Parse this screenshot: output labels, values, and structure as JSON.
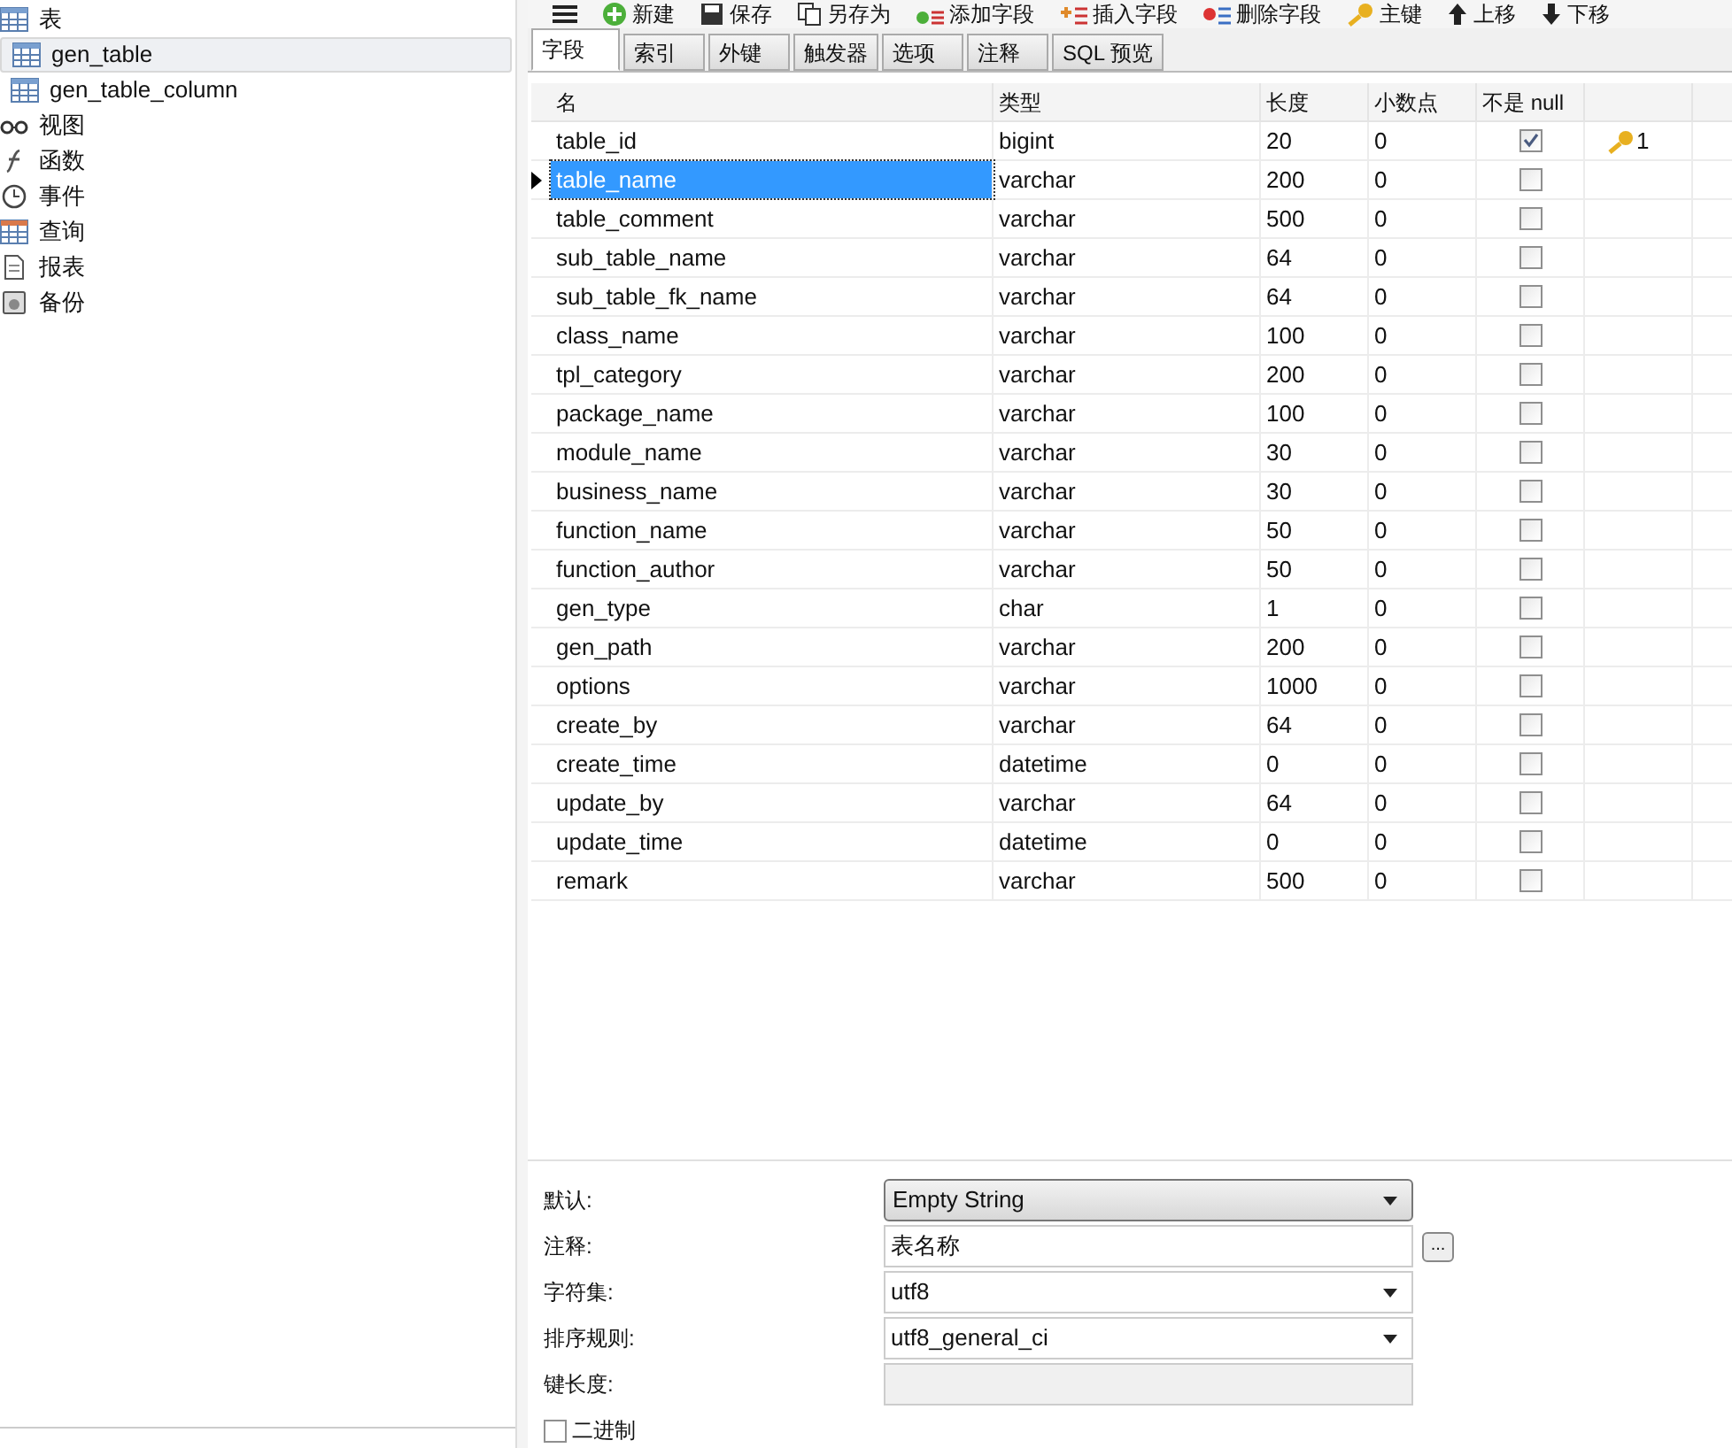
{
  "sidebar": {
    "items": [
      {
        "label": "表",
        "kind": "table-group",
        "selected": false,
        "children": [
          {
            "label": "gen_table",
            "kind": "table",
            "selected": true
          },
          {
            "label": "gen_table_column",
            "kind": "table",
            "selected": false
          }
        ]
      },
      {
        "label": "视图",
        "kind": "view",
        "selected": false
      },
      {
        "label": "函数",
        "kind": "function",
        "selected": false
      },
      {
        "label": "事件",
        "kind": "event",
        "selected": false
      },
      {
        "label": "查询",
        "kind": "query",
        "selected": false
      },
      {
        "label": "报表",
        "kind": "report",
        "selected": false
      },
      {
        "label": "备份",
        "kind": "backup",
        "selected": false
      }
    ]
  },
  "toolbar": [
    {
      "label": "新建",
      "kind": "new"
    },
    {
      "label": "保存",
      "kind": "save"
    },
    {
      "label": "另存为",
      "kind": "saveas"
    },
    {
      "label": "添加字段",
      "kind": "add"
    },
    {
      "label": "插入字段",
      "kind": "insert"
    },
    {
      "label": "删除字段",
      "kind": "delete"
    },
    {
      "label": "主键",
      "kind": "key"
    },
    {
      "label": "上移",
      "kind": "up"
    },
    {
      "label": "下移",
      "kind": "down"
    }
  ],
  "tabs": [
    {
      "label": "字段",
      "selected": true
    },
    {
      "label": "索引",
      "selected": false
    },
    {
      "label": "外键",
      "selected": false
    },
    {
      "label": "触发器",
      "selected": false
    },
    {
      "label": "选项",
      "selected": false
    },
    {
      "label": "注释",
      "selected": false
    },
    {
      "label": "SQL 预览",
      "selected": false
    }
  ],
  "table": {
    "columns": [
      "名",
      "类型",
      "长度",
      "小数点",
      "不是 null"
    ],
    "rows": [
      {
        "name": "table_id",
        "type": "bigint",
        "length": "20",
        "decimals": "0",
        "not_null": true,
        "key": "1",
        "selected": false
      },
      {
        "name": "table_name",
        "type": "varchar",
        "length": "200",
        "decimals": "0",
        "not_null": false,
        "selected": true
      },
      {
        "name": "table_comment",
        "type": "varchar",
        "length": "500",
        "decimals": "0",
        "not_null": false,
        "selected": false
      },
      {
        "name": "sub_table_name",
        "type": "varchar",
        "length": "64",
        "decimals": "0",
        "not_null": false,
        "selected": false
      },
      {
        "name": "sub_table_fk_name",
        "type": "varchar",
        "length": "64",
        "decimals": "0",
        "not_null": false,
        "selected": false
      },
      {
        "name": "class_name",
        "type": "varchar",
        "length": "100",
        "decimals": "0",
        "not_null": false,
        "selected": false
      },
      {
        "name": "tpl_category",
        "type": "varchar",
        "length": "200",
        "decimals": "0",
        "not_null": false,
        "selected": false
      },
      {
        "name": "package_name",
        "type": "varchar",
        "length": "100",
        "decimals": "0",
        "not_null": false,
        "selected": false
      },
      {
        "name": "module_name",
        "type": "varchar",
        "length": "30",
        "decimals": "0",
        "not_null": false,
        "selected": false
      },
      {
        "name": "business_name",
        "type": "varchar",
        "length": "30",
        "decimals": "0",
        "not_null": false,
        "selected": false
      },
      {
        "name": "function_name",
        "type": "varchar",
        "length": "50",
        "decimals": "0",
        "not_null": false,
        "selected": false
      },
      {
        "name": "function_author",
        "type": "varchar",
        "length": "50",
        "decimals": "0",
        "not_null": false,
        "selected": false
      },
      {
        "name": "gen_type",
        "type": "char",
        "length": "1",
        "decimals": "0",
        "not_null": false,
        "selected": false
      },
      {
        "name": "gen_path",
        "type": "varchar",
        "length": "200",
        "decimals": "0",
        "not_null": false,
        "selected": false
      },
      {
        "name": "options",
        "type": "varchar",
        "length": "1000",
        "decimals": "0",
        "not_null": false,
        "selected": false
      },
      {
        "name": "create_by",
        "type": "varchar",
        "length": "64",
        "decimals": "0",
        "not_null": false,
        "selected": false
      },
      {
        "name": "create_time",
        "type": "datetime",
        "length": "0",
        "decimals": "0",
        "not_null": false,
        "selected": false
      },
      {
        "name": "update_by",
        "type": "varchar",
        "length": "64",
        "decimals": "0",
        "not_null": false,
        "selected": false
      },
      {
        "name": "update_time",
        "type": "datetime",
        "length": "0",
        "decimals": "0",
        "not_null": false,
        "selected": false
      },
      {
        "name": "remark",
        "type": "varchar",
        "length": "500",
        "decimals": "0",
        "not_null": false,
        "selected": false
      }
    ]
  },
  "properties": [
    {
      "label": "默认:",
      "value": "Empty String",
      "kind": "combo"
    },
    {
      "label": "注释:",
      "value": "表名称",
      "kind": "text-button",
      "button": "..."
    },
    {
      "label": "字符集:",
      "value": "utf8",
      "kind": "select"
    },
    {
      "label": "排序规则:",
      "value": "utf8_general_ci",
      "kind": "select"
    },
    {
      "label": "键长度:",
      "kind": "disabled"
    }
  ],
  "binary": {
    "label": "二进制",
    "checked": false
  }
}
